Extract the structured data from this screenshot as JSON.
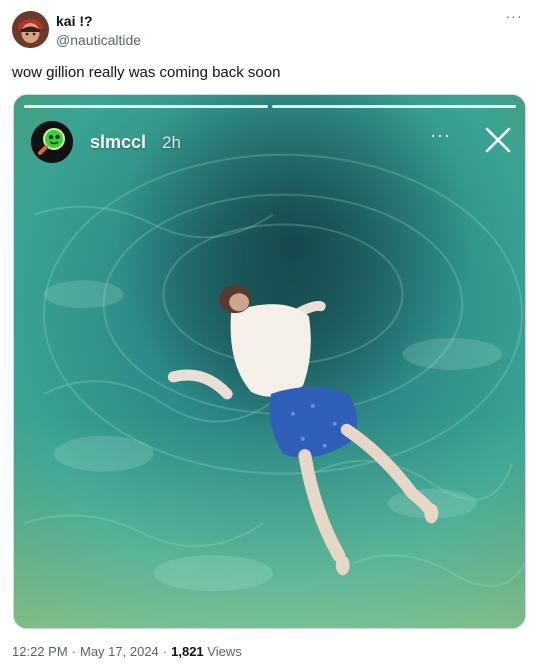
{
  "tweet": {
    "author": {
      "display_name": "kai !?",
      "handle": "@nauticaltide"
    },
    "more_label": "···",
    "text": "wow gillion really was coming back soon",
    "time": "12:22 PM",
    "date": "May 17, 2024",
    "separator": "·",
    "views_count": "1,821",
    "views_label": "Views"
  },
  "story": {
    "username": "slmccl",
    "age": "2h",
    "more_label": "···",
    "progress_segments": 2,
    "avatar_icon": "green-creature-magnifier-icon",
    "close_icon": "close-icon"
  },
  "colors": {
    "text_primary": "#0f1419",
    "text_secondary": "#536471",
    "water": "#2f8f8a",
    "swim_trunks": "#2f5fb8"
  }
}
